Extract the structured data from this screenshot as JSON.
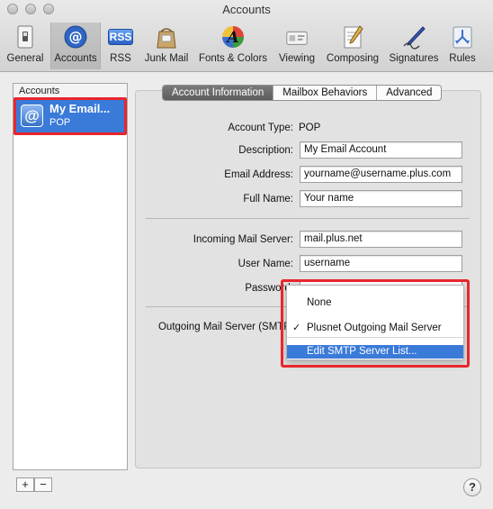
{
  "window": {
    "title": "Accounts"
  },
  "toolbar": {
    "items": [
      {
        "label": "General",
        "icon": "switch-icon"
      },
      {
        "label": "Accounts",
        "icon": "at-icon"
      },
      {
        "label": "RSS",
        "icon": "rss-icon"
      },
      {
        "label": "Junk Mail",
        "icon": "junk-mail-icon"
      },
      {
        "label": "Fonts & Colors",
        "icon": "fonts-colors-icon"
      },
      {
        "label": "Viewing",
        "icon": "viewing-icon"
      },
      {
        "label": "Composing",
        "icon": "composing-icon"
      },
      {
        "label": "Signatures",
        "icon": "signatures-icon"
      },
      {
        "label": "Rules",
        "icon": "rules-icon"
      }
    ],
    "selected": "Accounts",
    "rss_badge": "RSS",
    "fonts_glyph": "A"
  },
  "accounts": {
    "header": "Accounts",
    "items": [
      {
        "name": "My Email...",
        "type": "POP",
        "icon_glyph": "@"
      }
    ],
    "add_label": "+",
    "remove_label": "−"
  },
  "tabs": [
    {
      "label": "Account Information",
      "active": true
    },
    {
      "label": "Mailbox Behaviors",
      "active": false
    },
    {
      "label": "Advanced",
      "active": false
    }
  ],
  "form": {
    "account_type_label": "Account Type:",
    "account_type_value": "POP",
    "description_label": "Description:",
    "description_value": "My Email Account",
    "email_label": "Email Address:",
    "email_value": "yourname@username.plus.com",
    "fullname_label": "Full Name:",
    "fullname_value": "Your name",
    "incoming_label": "Incoming Mail Server:",
    "incoming_value": "mail.plus.net",
    "username_label": "User Name:",
    "username_value": "username",
    "password_label": "Password:",
    "outgoing_label": "Outgoing Mail Server (SMTP):"
  },
  "smtp_menu": {
    "items": [
      {
        "label": "None",
        "checked": false
      },
      {
        "label": "Plusnet Outgoing Mail Server",
        "checked": true
      },
      {
        "label": "Edit SMTP Server List...",
        "highlighted": true
      }
    ],
    "check_glyph": "✓"
  },
  "help": {
    "label": "?"
  },
  "colors": {
    "selection": "#3a7ad9",
    "highlight_frame": "#e8262c"
  }
}
